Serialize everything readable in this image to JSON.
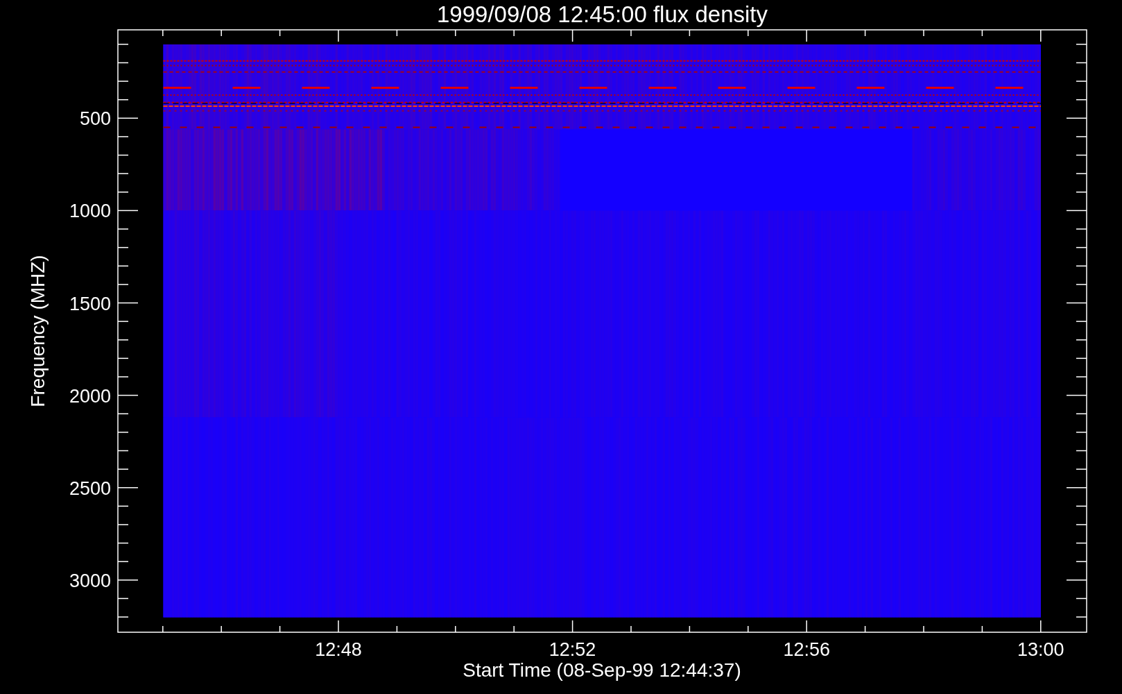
{
  "plot": {
    "title": "1999/09/08 12:45:00 flux density",
    "xlabel": "Start Time (08-Sep-99 12:44:37)",
    "ylabel": "Frequency (MHZ)",
    "xticks": [
      "12:48",
      "12:52",
      "12:56",
      "13:00"
    ],
    "yticks": [
      "500",
      "1000",
      "1500",
      "2000",
      "2500",
      "3000"
    ]
  }
}
